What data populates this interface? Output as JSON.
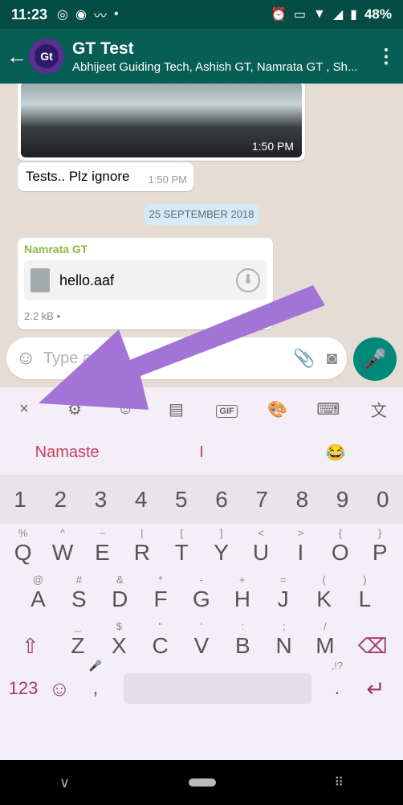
{
  "status_bar": {
    "time": "11:23",
    "battery": "48%"
  },
  "header": {
    "avatar_logo": "Gt",
    "title": "GT Test",
    "subtitle": "Abhijeet Guiding Tech, Ashish GT, Namrata GT , Sh..."
  },
  "chat": {
    "image_time": "1:50 PM",
    "text_message": "Tests.. Plz ignore",
    "text_time": "1:50 PM",
    "date_chip": "25 SEPTEMBER 2018",
    "file_sender": "Namrata GT",
    "file_name": "hello.aaf",
    "file_size": "2.2 kB •",
    "file_time": "3:"
  },
  "composer": {
    "placeholder": "Type a"
  },
  "keyboard": {
    "toolbar": [
      "×",
      "⚙",
      "☺",
      "▤",
      "GIF",
      "🎨",
      "⌨",
      "文"
    ],
    "suggestions": [
      "Namaste",
      "I",
      "😂"
    ],
    "numbers": [
      "1",
      "2",
      "3",
      "4",
      "5",
      "6",
      "7",
      "8",
      "9",
      "0"
    ],
    "row1": [
      {
        "k": "Q",
        "h": "%"
      },
      {
        "k": "W",
        "h": "^"
      },
      {
        "k": "E",
        "h": "~"
      },
      {
        "k": "R",
        "h": "|"
      },
      {
        "k": "T",
        "h": "["
      },
      {
        "k": "Y",
        "h": "]"
      },
      {
        "k": "U",
        "h": "<"
      },
      {
        "k": "I",
        "h": ">"
      },
      {
        "k": "O",
        "h": "{"
      },
      {
        "k": "P",
        "h": "}"
      }
    ],
    "row2": [
      {
        "k": "A",
        "h": "@"
      },
      {
        "k": "S",
        "h": "#"
      },
      {
        "k": "D",
        "h": "&"
      },
      {
        "k": "F",
        "h": "*"
      },
      {
        "k": "G",
        "h": "-"
      },
      {
        "k": "H",
        "h": "+"
      },
      {
        "k": "J",
        "h": "="
      },
      {
        "k": "K",
        "h": "("
      },
      {
        "k": "L",
        "h": ")"
      }
    ],
    "row3": [
      {
        "k": "Z",
        "h": "_"
      },
      {
        "k": "X",
        "h": "$"
      },
      {
        "k": "C",
        "h": "\""
      },
      {
        "k": "V",
        "h": "'"
      },
      {
        "k": "B",
        "h": ":"
      },
      {
        "k": "N",
        "h": ";"
      },
      {
        "k": "M",
        "h": "/"
      }
    ],
    "key_123": "123",
    "comma": ",",
    "dot": ".",
    "dot_hint": ",!?"
  },
  "colors": {
    "header": "#075e54",
    "accent": "#00897b",
    "keyboard_accent": "#a3386a",
    "arrow": "#a274d8"
  }
}
